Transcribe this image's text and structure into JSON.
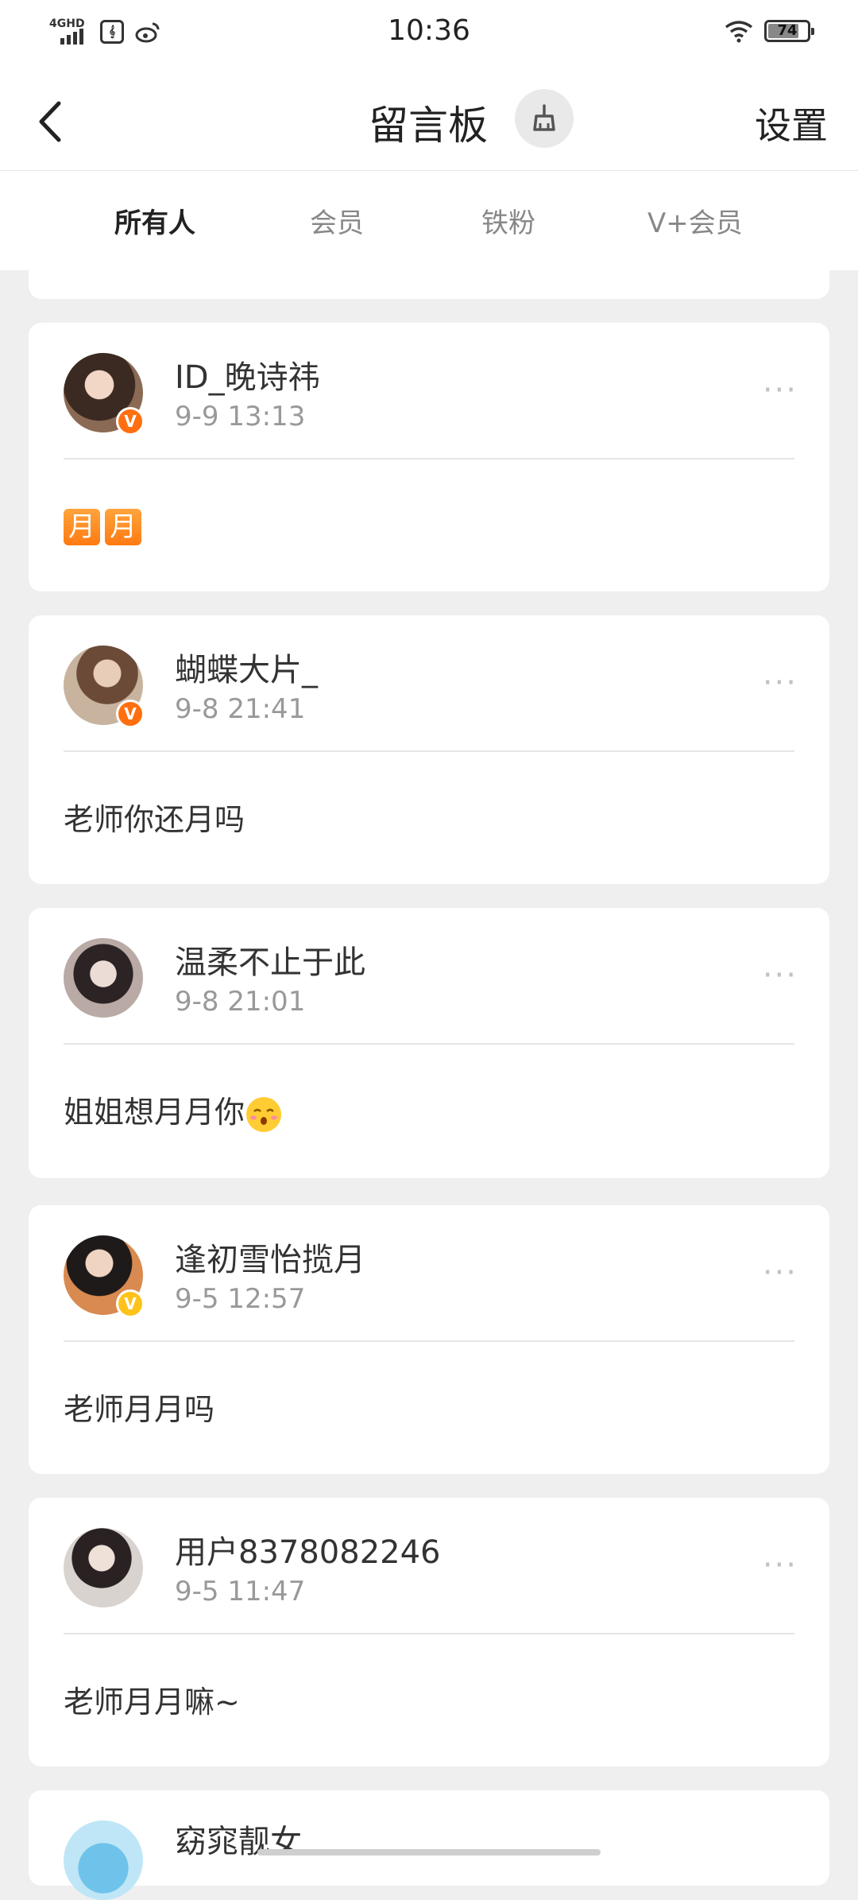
{
  "status_bar": {
    "network": "4GHD",
    "app_icon_text": "𝄞",
    "time": "10:36",
    "battery_level": "74",
    "icons": [
      "signal-icon",
      "notification-app-icon",
      "weibo-icon",
      "wifi-icon",
      "battery-icon"
    ]
  },
  "navbar": {
    "title": "留言板",
    "settings_label": "设置",
    "icons": [
      "back-arrow-icon",
      "broom-clean-icon"
    ]
  },
  "tabs": [
    {
      "label": "所有人",
      "active": true
    },
    {
      "label": "会员",
      "active": false
    },
    {
      "label": "铁粉",
      "active": false
    },
    {
      "label": "V+会员",
      "active": false
    }
  ],
  "colors": {
    "accent": "#ff8200",
    "badge_orange": "#ff6f0f",
    "badge_gold": "#ffc21a",
    "background": "#efefef"
  },
  "messages": [
    {
      "name": "ID_晚诗祎",
      "time": "9-9 13:13",
      "text": "",
      "emoji": "月月",
      "badge": "orange"
    },
    {
      "name": "蝴蝶大片_",
      "time": "9-8 21:41",
      "text": "老师你还月吗",
      "badge": "orange"
    },
    {
      "name": "温柔不止于此",
      "time": "9-8 21:01",
      "text": "姐姐想月月你",
      "trailing_emoji": "face-blush-icon",
      "badge": "none"
    },
    {
      "name": "逢初雪怡揽月",
      "time": "9-5 12:57",
      "text": "老师月月吗",
      "badge": "gold"
    },
    {
      "name": "用户8378082246",
      "time": "9-5 11:47",
      "text": "老师月月嘛~",
      "badge": "none"
    },
    {
      "name": "窈窕靓女",
      "time": "",
      "text": "",
      "badge": "none"
    }
  ],
  "more_label": "···"
}
